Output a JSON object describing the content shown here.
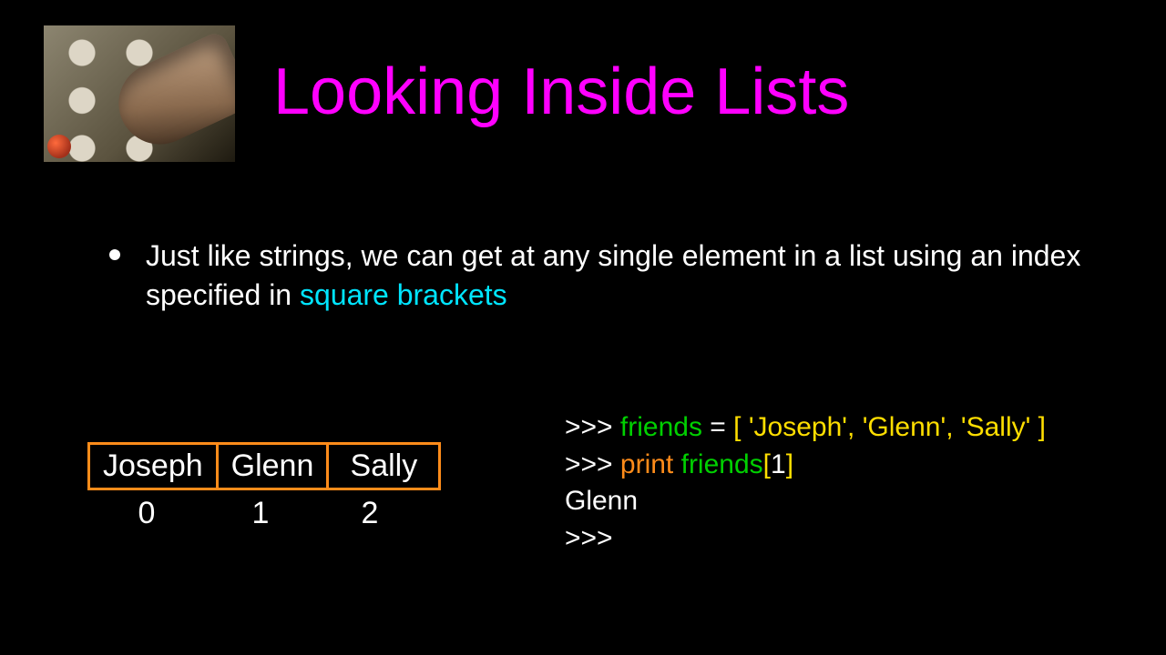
{
  "title": "Looking Inside Lists",
  "bullet": {
    "part1": "Just like strings, we can get at any single element in a list using an index specified in ",
    "highlight": "square brackets"
  },
  "array": {
    "cells": [
      "Joseph",
      "Glenn",
      "Sally"
    ],
    "indices": [
      "0",
      "1",
      "2"
    ]
  },
  "code": {
    "l1_prompt": ">>> ",
    "l1_var": "friends",
    "l1_eq": " = ",
    "l1_list": "[ 'Joseph', 'Glenn', 'Sally' ]",
    "l2_prompt": ">>> ",
    "l2_print": "print",
    "l2_sp": " ",
    "l2_var": "friends",
    "l2_lb": "[",
    "l2_idx": "1",
    "l2_rb": "]",
    "l3_out": "Glenn",
    "l4_prompt": ">>>"
  }
}
